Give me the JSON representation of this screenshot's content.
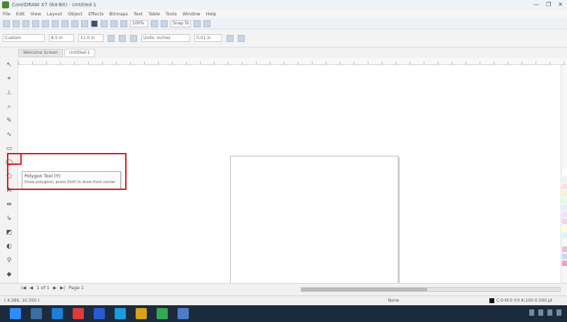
{
  "window": {
    "title": "CorelDRAW X7 (64-Bit) - Untitled-1",
    "controls": [
      "—",
      "❐",
      "✕"
    ]
  },
  "menu": [
    "File",
    "Edit",
    "View",
    "Layout",
    "Object",
    "Effects",
    "Bitmaps",
    "Text",
    "Table",
    "Tools",
    "Window",
    "Help"
  ],
  "toolbar": {
    "zoom_select": "100%",
    "snap_select": "Snap To"
  },
  "propbar": {
    "page_size_select": "Custom",
    "width": "8.5 in",
    "height": "11.0 in",
    "units_select": "Units: inches",
    "nudge": "0.01 in"
  },
  "tabs": [
    {
      "label": "Welcome Screen",
      "active": false
    },
    {
      "label": "Untitled-1",
      "active": true
    }
  ],
  "tooltip": {
    "title": "Polygon Tool (Y)",
    "description": "Draw polygons; press Shift to draw from center"
  },
  "bottom": {
    "page_nav": [
      "|◀",
      "◀",
      "1 of 1",
      "▶",
      "▶|"
    ],
    "page_tab": "Page 1"
  },
  "status": {
    "coordinates": "( 4.286, 10.350 )",
    "fill_label": "None",
    "outline_label": "C:0 M:0 Y:0 K:100 0.500 pt"
  },
  "colors": {
    "highlight": "#e01818",
    "taskbar": "#1c2a3d"
  }
}
